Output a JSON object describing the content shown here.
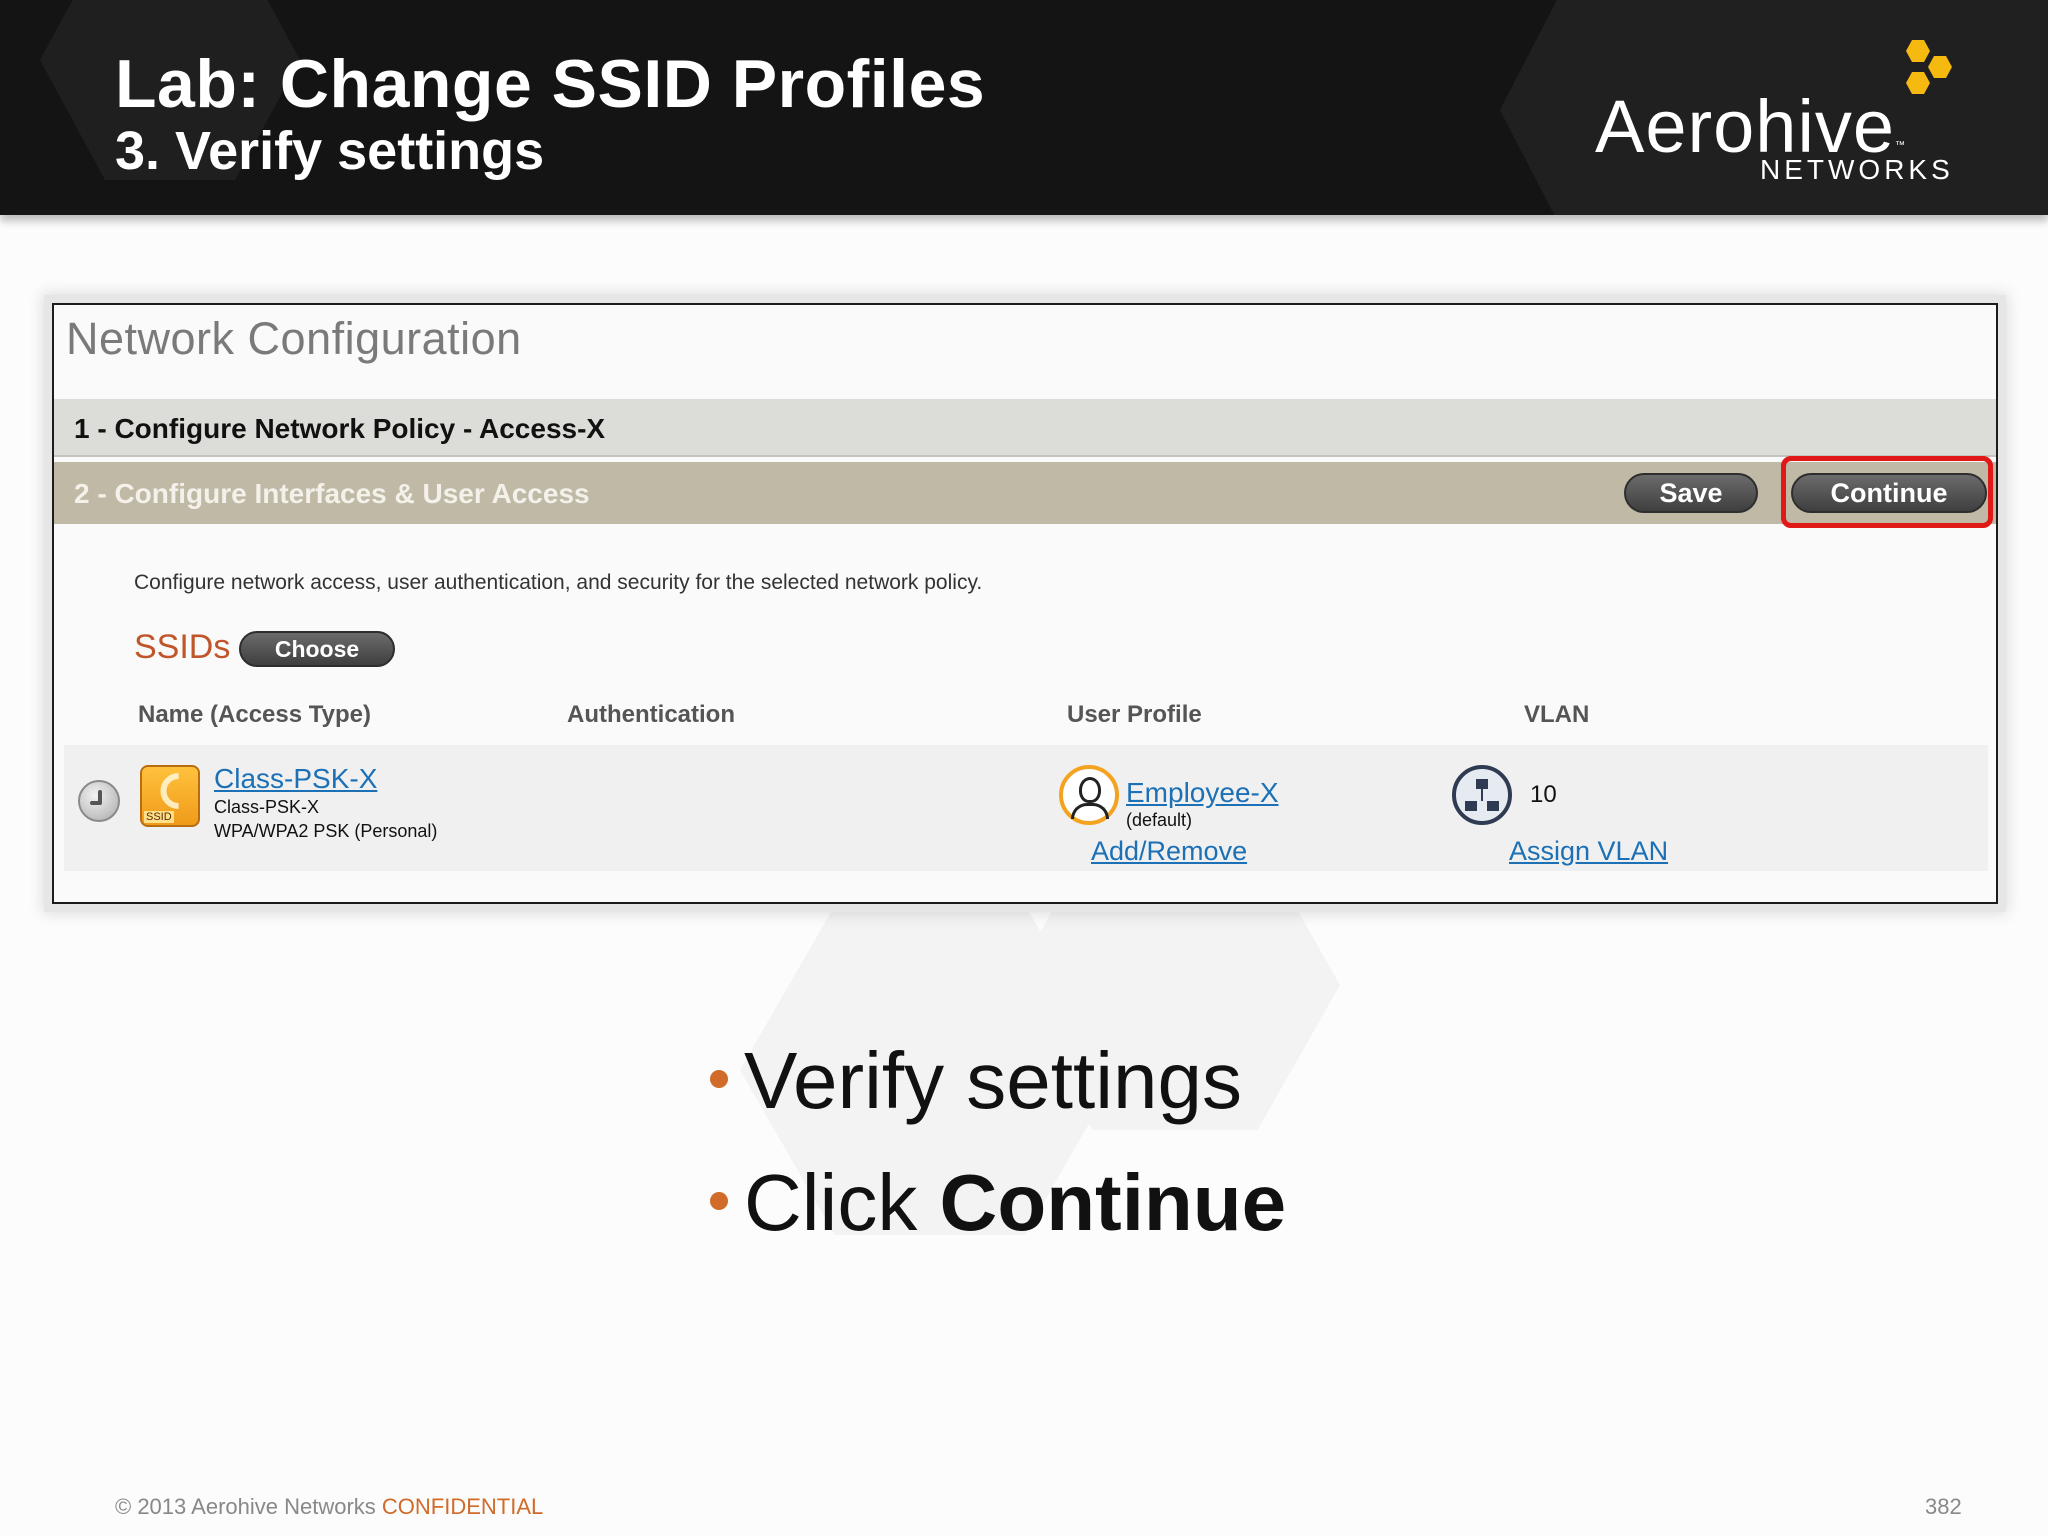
{
  "slide": {
    "title": "Lab: Change SSID Profiles",
    "subtitle": "3.  Verify settings"
  },
  "brand": {
    "name": "Aerohive",
    "tm": "™",
    "sub": "NETWORKS",
    "colors": {
      "mark": "#f5b90f",
      "header_bg": "#141414"
    }
  },
  "screenshot": {
    "title": "Network Configuration",
    "step1_label": "1 - Configure Network Policy - Access-X",
    "step2_label": "2 - Configure Interfaces & User Access",
    "save_label": "Save",
    "continue_label": "Continue",
    "intro_text": "Configure network access, user authentication, and security for the selected network policy.",
    "ssids_label": "SSIDs",
    "choose_label": "Choose",
    "columns": {
      "name": "Name (Access Type)",
      "auth": "Authentication",
      "user_profile": "User Profile",
      "vlan": "VLAN"
    },
    "row": {
      "ssid_link": "Class-PSK-X",
      "ssid_name": "Class-PSK-X",
      "ssid_security": "WPA/WPA2 PSK (Personal)",
      "ssid_icon_tag": "SSID",
      "user_profile_link": "Employee-X",
      "user_profile_note": "(default)",
      "add_remove_link": "Add/Remove",
      "vlan_value": "10",
      "assign_vlan_link": "Assign VLAN"
    },
    "colors": {
      "highlight": "#e01818",
      "link": "#1c70b6",
      "ssids_label": "#c0552a"
    }
  },
  "bullets": {
    "b1": "Verify settings",
    "b2_prefix": "Click ",
    "b2_strong": "Continue"
  },
  "footer": {
    "copyright": "© 2013 Aerohive Networks ",
    "confidential": "CONFIDENTIAL",
    "page": "382"
  }
}
